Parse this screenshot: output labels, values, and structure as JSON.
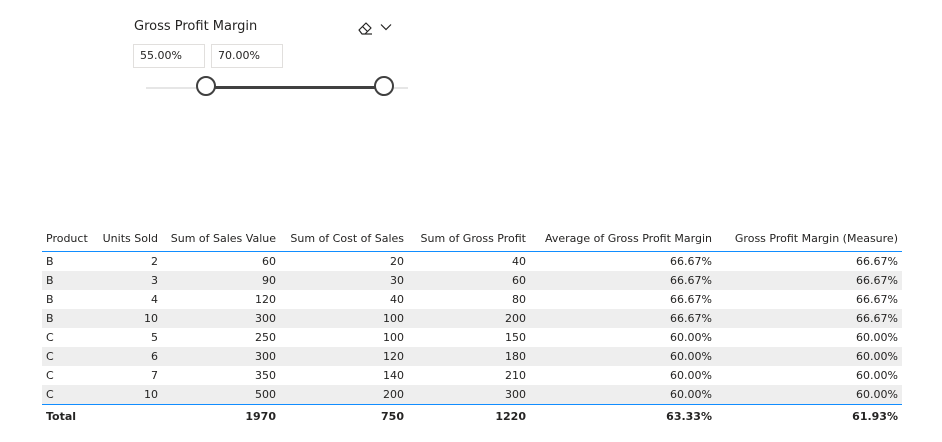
{
  "slicer": {
    "title": "Gross Profit Margin",
    "min_value": "55.00%",
    "max_value": "70.00%",
    "range_min_fraction": 0.23,
    "range_max_fraction": 0.91,
    "eraser_icon": "eraser-icon",
    "chevron_icon": "chevron-down-icon"
  },
  "table": {
    "columns": [
      "Product",
      "Units Sold",
      "Sum of Sales Value",
      "Sum of Cost of Sales",
      "Sum of Gross Profit",
      "Average of Gross Profit Margin",
      "Gross Profit Margin (Measure)"
    ],
    "rows": [
      [
        "B",
        "2",
        "60",
        "20",
        "40",
        "66.67%",
        "66.67%"
      ],
      [
        "B",
        "3",
        "90",
        "30",
        "60",
        "66.67%",
        "66.67%"
      ],
      [
        "B",
        "4",
        "120",
        "40",
        "80",
        "66.67%",
        "66.67%"
      ],
      [
        "B",
        "10",
        "300",
        "100",
        "200",
        "66.67%",
        "66.67%"
      ],
      [
        "C",
        "5",
        "250",
        "100",
        "150",
        "60.00%",
        "60.00%"
      ],
      [
        "C",
        "6",
        "300",
        "120",
        "180",
        "60.00%",
        "60.00%"
      ],
      [
        "C",
        "7",
        "350",
        "140",
        "210",
        "60.00%",
        "60.00%"
      ],
      [
        "C",
        "10",
        "500",
        "200",
        "300",
        "60.00%",
        "60.00%"
      ]
    ],
    "total": [
      "Total",
      "",
      "1970",
      "750",
      "1220",
      "63.33%",
      "61.93%"
    ]
  },
  "colors": {
    "accent": "#118dff",
    "slider": "#404040",
    "stripe": "#eeeeee"
  }
}
